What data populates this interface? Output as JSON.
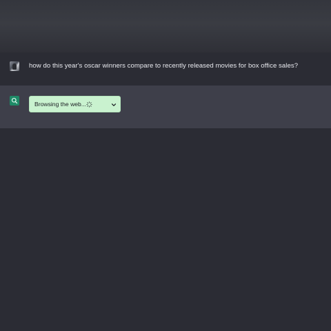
{
  "conversation": {
    "user_message": {
      "text": "how do this year's oscar winners compare to recently released movies for box office sales?",
      "avatar_icon": "user-avatar-photo"
    },
    "assistant_message": {
      "avatar_icon": "search-icon",
      "status_pill": {
        "label": "Browsing the web...",
        "spinner_icon": "loading-spinner-icon",
        "toggle_icon": "chevron-down-icon"
      }
    }
  },
  "colors": {
    "background": "#2b2c34",
    "assistant_row": "#3e3f4a",
    "assistant_avatar": "#1e8a67",
    "status_pill": "#c9f2cf",
    "user_text": "#e8e9ee"
  }
}
